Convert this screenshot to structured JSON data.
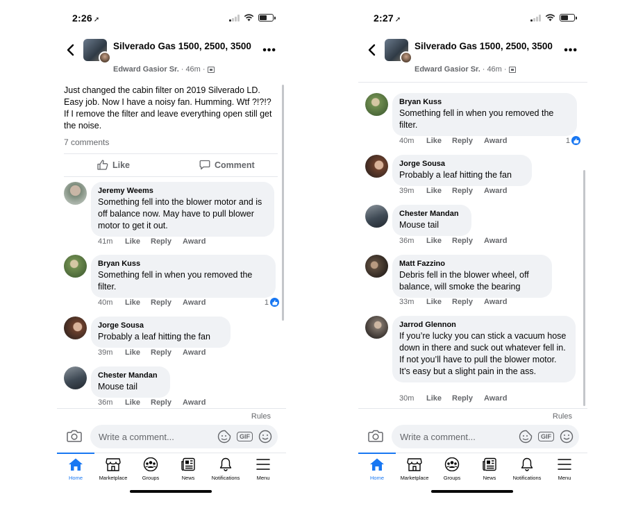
{
  "left": {
    "status": {
      "time": "2:26"
    },
    "header": {
      "group_name": "Silverado Gas 1500, 2500, 3500",
      "author": "Edward Gasior Sr.",
      "separator": "·",
      "time": "46m"
    },
    "post": {
      "text": "Just changed the cabin filter on 2019 Silverado LD.  Easy job.  Now I have a noisy fan.  Humming. Wtf ?!?!?  If I remove the filter and leave everything open still get the noise.",
      "comments_count": "7 comments",
      "like_label": "Like",
      "comment_label": "Comment"
    },
    "comments": [
      {
        "author": "Jeremy Weems",
        "text": "Something fell into the blower motor and is off balance now. May have to pull blower motor to get it out.",
        "time": "41m",
        "like": "Like",
        "reply": "Reply",
        "award": "Award",
        "reactions": ""
      },
      {
        "author": "Bryan Kuss",
        "text": "Something fell in when you removed the filter.",
        "time": "40m",
        "like": "Like",
        "reply": "Reply",
        "award": "Award",
        "reactions": "1"
      },
      {
        "author": "Jorge Sousa",
        "text": "Probably a leaf hitting the fan",
        "time": "39m",
        "like": "Like",
        "reply": "Reply",
        "award": "Award",
        "reactions": ""
      },
      {
        "author": "Chester Mandan",
        "text": "Mouse tail",
        "time": "36m",
        "like": "Like",
        "reply": "Reply",
        "award": "Award",
        "reactions": ""
      }
    ],
    "rules": "Rules",
    "composer": {
      "placeholder": "Write a comment...",
      "gif": "GIF"
    }
  },
  "right": {
    "status": {
      "time": "2:27"
    },
    "header": {
      "group_name": "Silverado Gas 1500, 2500, 3500",
      "author": "Edward Gasior Sr.",
      "separator": "·",
      "time": "46m"
    },
    "comments": [
      {
        "author": "Bryan Kuss",
        "text": "Something fell in when you removed the filter.",
        "time": "40m",
        "like": "Like",
        "reply": "Reply",
        "award": "Award",
        "reactions": "1"
      },
      {
        "author": "Jorge Sousa",
        "text": "Probably a leaf hitting the fan",
        "time": "39m",
        "like": "Like",
        "reply": "Reply",
        "award": "Award",
        "reactions": ""
      },
      {
        "author": "Chester Mandan",
        "text": "Mouse tail",
        "time": "36m",
        "like": "Like",
        "reply": "Reply",
        "award": "Award",
        "reactions": ""
      },
      {
        "author": "Matt Fazzino",
        "text": "Debris fell in the blower wheel, off balance, will smoke the bearing",
        "time": "33m",
        "like": "Like",
        "reply": "Reply",
        "award": "Award",
        "reactions": ""
      },
      {
        "author": "Jarrod Glennon",
        "text": "If you’re lucky you can stick a vacuum hose down in there and suck out whatever fell in. If not you’ll have to pull the blower motor. It’s easy but a slight pain in the ass.",
        "time": "30m",
        "like": "Like",
        "reply": "Reply",
        "award": "Award",
        "reactions": ""
      }
    ],
    "rules": "Rules",
    "composer": {
      "placeholder": "Write a comment...",
      "gif": "GIF"
    }
  },
  "tabs": [
    "Home",
    "Marketplace",
    "Groups",
    "News",
    "Notifications",
    "Menu"
  ],
  "colors": {
    "accent": "#1877f2",
    "bubble": "#f0f2f5",
    "muted": "#65676b"
  }
}
